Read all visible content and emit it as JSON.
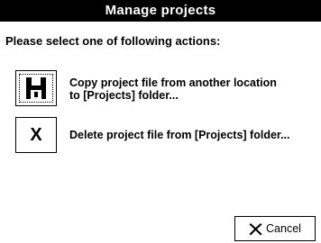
{
  "window": {
    "title": "Manage projects"
  },
  "prompt": "Please select one of following actions:",
  "actions": [
    {
      "icon": "floppy-disk-icon",
      "label_lines": [
        "Copy project file from another location",
        "to [Projects] folder..."
      ]
    },
    {
      "icon": "x-icon",
      "glyph": "X",
      "label": "Delete project file from [Projects] folder..."
    }
  ],
  "cancel": {
    "icon": "x-icon",
    "label": "Cancel"
  }
}
